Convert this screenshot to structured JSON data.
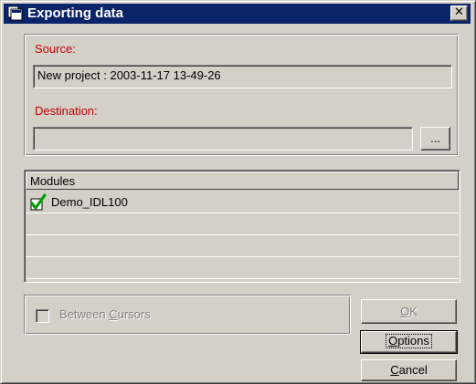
{
  "window": {
    "title": "Exporting data"
  },
  "source": {
    "label": "Source:",
    "value": "New project : 2003-11-17 13-49-26"
  },
  "destination": {
    "label": "Destination:",
    "value": "",
    "browse_label": "..."
  },
  "modules": {
    "header": "Modules",
    "items": [
      {
        "name": "Demo_IDL100",
        "checked": true
      }
    ]
  },
  "between_cursors": {
    "label_prefix": "Between ",
    "label_hotkey": "C",
    "label_suffix": "ursors",
    "checked": false,
    "enabled": false
  },
  "buttons": {
    "ok": {
      "hotkey": "O",
      "rest": "K",
      "enabled": false
    },
    "options": {
      "hotkey": "O",
      "rest": "ptions"
    },
    "cancel": {
      "hotkey": "C",
      "rest": "ancel"
    }
  },
  "icons": {
    "title": "window-icon",
    "check": "checkmark-icon",
    "close": "close-icon"
  },
  "colors": {
    "titlebar": "#0a246a",
    "face": "#d4d0c8",
    "label_red": "#c00000",
    "check_green": "#00a000"
  }
}
